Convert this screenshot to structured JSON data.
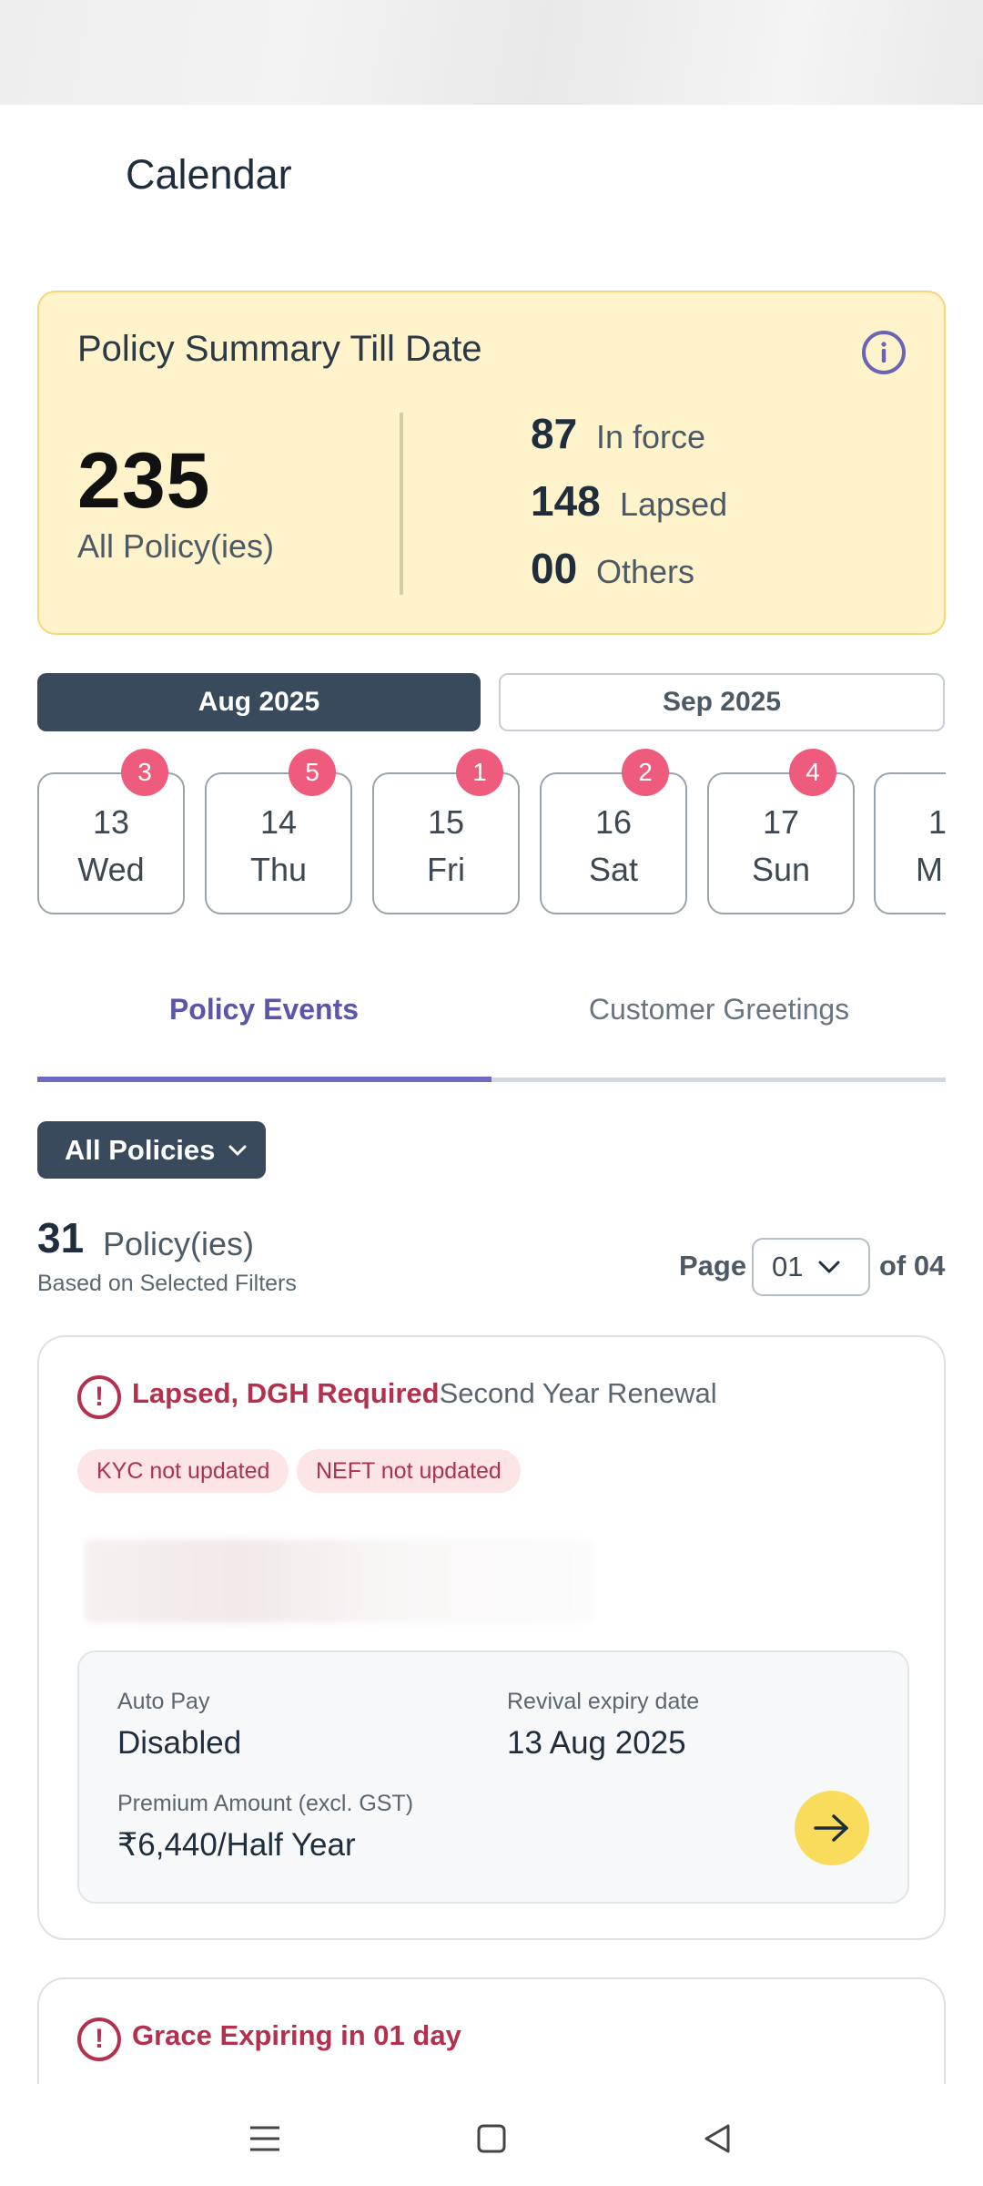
{
  "page": {
    "title": "Calendar"
  },
  "summary": {
    "title": "Policy Summary Till Date",
    "total": "235",
    "total_label": "All Policy(ies)",
    "stats": [
      {
        "num": "87",
        "label": "In force"
      },
      {
        "num": "148",
        "label": "Lapsed"
      },
      {
        "num": "00",
        "label": "Others"
      }
    ]
  },
  "months": {
    "active": "Aug 2025",
    "inactive": "Sep 2025"
  },
  "dates": [
    {
      "day": "13",
      "weekday": "Wed",
      "badge": "3"
    },
    {
      "day": "14",
      "weekday": "Thu",
      "badge": "5"
    },
    {
      "day": "15",
      "weekday": "Fri",
      "badge": "1"
    },
    {
      "day": "16",
      "weekday": "Sat",
      "badge": "2"
    },
    {
      "day": "17",
      "weekday": "Sun",
      "badge": "4"
    },
    {
      "day": "1",
      "weekday": "M",
      "badge": ""
    }
  ],
  "tabs": {
    "active": "Policy Events",
    "inactive": "Customer Greetings"
  },
  "filter": {
    "label": "All Policies"
  },
  "results": {
    "count": "31",
    "count_label": "Policy(ies)",
    "sub": "Based on Selected Filters",
    "page_label": "Page",
    "page_value": "01",
    "page_of": "of 04"
  },
  "policy_card": {
    "status_red": "Lapsed, DGH Required",
    "status_grey": "Second Year Renewal",
    "chips": [
      "KYC not updated",
      "NEFT not updated"
    ],
    "auto_pay_label": "Auto Pay",
    "auto_pay_value": "Disabled",
    "revival_label": "Revival expiry date",
    "revival_value": "13 Aug 2025",
    "premium_label": "Premium Amount (excl. GST)",
    "premium_value": "₹6,440/Half Year"
  },
  "policy_card_2": {
    "status": "Grace Expiring in 01 day"
  },
  "icons": {
    "info": "info-icon",
    "alert": "alert-icon",
    "arrow": "arrow-right-icon",
    "chevron": "chevron-down-icon",
    "nav": [
      "menu-icon",
      "home-square-icon",
      "back-triangle-icon"
    ]
  },
  "colors": {
    "dark_slate": "#384a5c",
    "summary_bg": "#fff3cc",
    "badge_pink": "#ef5b7c",
    "tab_purple": "#5a56a8",
    "alert_red": "#b3304f",
    "go_yellow": "#f9dc5c"
  }
}
